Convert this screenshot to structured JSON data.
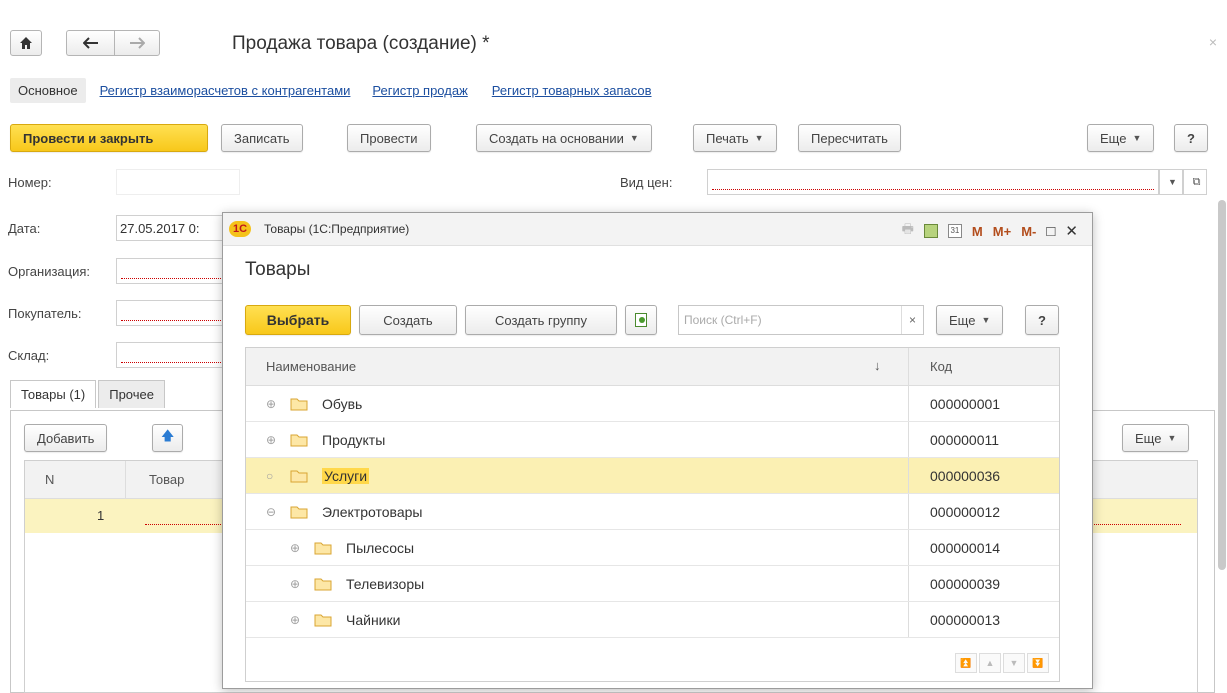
{
  "window": {
    "title": "Продажа товара (создание) *",
    "close_glyph": "×"
  },
  "tabs": {
    "active": "Основное",
    "links": [
      "Регистр взаиморасчетов с контрагентами",
      "Регистр продаж",
      "Регистр товарных запасов"
    ]
  },
  "toolbar": {
    "post_close": "Провести и закрыть",
    "save": "Записать",
    "post": "Провести",
    "create_based": "Создать на основании",
    "print": "Печать",
    "recalc": "Пересчитать",
    "more": "Еще",
    "help": "?"
  },
  "form": {
    "number_label": "Номер:",
    "number_value": "",
    "price_type_label": "Вид цен:",
    "date_label": "Дата:",
    "date_value": "27.05.2017 0:",
    "org_label": "Организация:",
    "buyer_label": "Покупатель:",
    "warehouse_label": "Склад:"
  },
  "bottom": {
    "tab_goods": "Товары (1)",
    "tab_other": "Прочее",
    "add": "Добавить",
    "more": "Еще",
    "col_n": "N",
    "col_goods": "Товар",
    "row1_n": "1"
  },
  "dialog": {
    "window_title": "Товары (1С:Предприятие)",
    "logo": "1С",
    "heading": "Товары",
    "select": "Выбрать",
    "create": "Создать",
    "create_group": "Создать группу",
    "search_placeholder": "Поиск (Ctrl+F)",
    "search_clear": "×",
    "more": "Еще",
    "help": "?",
    "col_name": "Наименование",
    "sort_arrow": "↓",
    "col_code": "Код",
    "items": [
      {
        "name": "Обувь",
        "code": "000000001",
        "level": 0,
        "expand": "⊕"
      },
      {
        "name": "Продукты",
        "code": "000000011",
        "level": 0,
        "expand": "⊕"
      },
      {
        "name": "Услуги",
        "code": "000000036",
        "level": 0,
        "expand": "○",
        "selected": true
      },
      {
        "name": "Электротовары",
        "code": "000000012",
        "level": 0,
        "expand": "⊖"
      },
      {
        "name": "Пылесосы",
        "code": "000000014",
        "level": 1,
        "expand": "⊕"
      },
      {
        "name": "Телевизоры",
        "code": "000000039",
        "level": 1,
        "expand": "⊕"
      },
      {
        "name": "Чайники",
        "code": "000000013",
        "level": 1,
        "expand": "⊕"
      }
    ],
    "title_icons": {
      "m": "M",
      "mplus": "M+",
      "mminus": "M-",
      "maximize": "□",
      "close": "✕"
    }
  },
  "colors": {
    "accent_yellow": "#f8c81a",
    "link_blue": "#1c4fa0",
    "selected_row": "#fbf0b3"
  }
}
